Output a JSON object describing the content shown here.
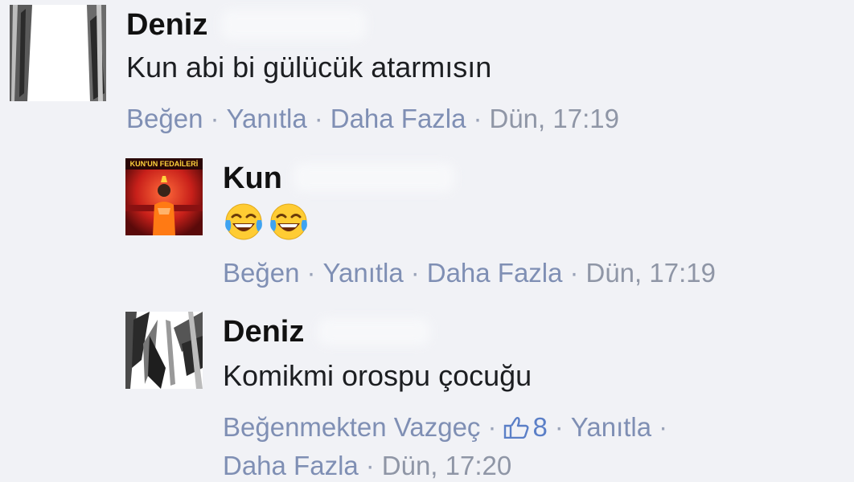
{
  "comments": [
    {
      "author": "Deniz",
      "text": "Kun abi bi gülücük atarmısın",
      "actions": [
        "Beğen",
        "Yanıtla",
        "Daha Fazla"
      ],
      "time": "Dün, 17:19"
    },
    {
      "author": "Kun",
      "avatar_label": "KUN'UN FEDAİLERİ",
      "emoji": "face-with-tears-of-joy-icon",
      "emoji_count": 2,
      "actions": [
        "Beğen",
        "Yanıtla",
        "Daha Fazla"
      ],
      "time": "Dün, 17:19"
    },
    {
      "author": "Deniz",
      "text": "Komikmi orospu çocuğu",
      "actions": [
        "Beğenmekten Vazgeç",
        "Yanıtla",
        "Daha Fazla"
      ],
      "like_count": "8",
      "time": "Dün, 17:20"
    }
  ],
  "colors": {
    "background": "#f1f2f6",
    "link": "#7f8fb4",
    "like": "#5b7fc7"
  }
}
